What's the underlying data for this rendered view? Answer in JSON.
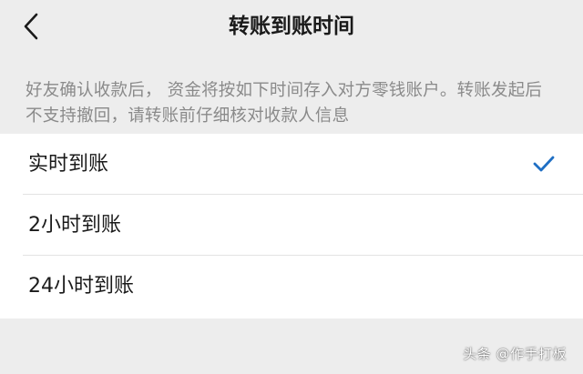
{
  "header": {
    "title": "转账到账时间",
    "back_icon": "chevron-left-icon"
  },
  "description": "好友确认收款后， 资金将按如下时间存入对方零钱账户。转账发起后不支持撤回，请转账前仔细核对收款人信息",
  "options": [
    {
      "label": "实时到账",
      "selected": true
    },
    {
      "label": "2小时到账",
      "selected": false
    },
    {
      "label": "24小时到账",
      "selected": false
    }
  ],
  "check_icon": "checkmark-icon",
  "accent_color": "#1f6fc4",
  "watermark": "头条 @作手打板"
}
